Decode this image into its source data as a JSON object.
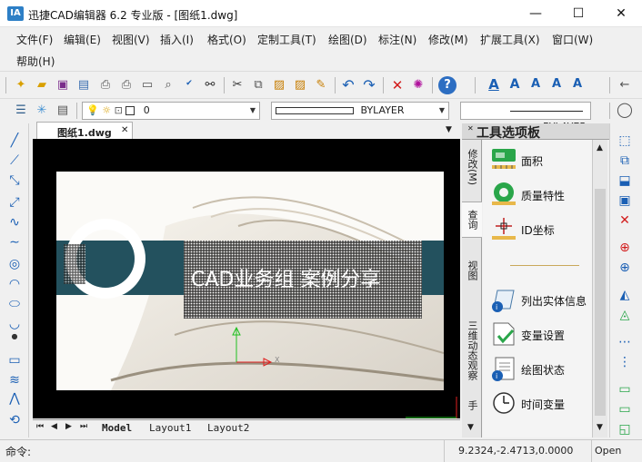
{
  "window": {
    "logo_text": "IA",
    "title": "迅捷CAD编辑器 6.2 专业版  - [图纸1.dwg]",
    "minimize_glyph": "—",
    "maximize_glyph": "☐",
    "close_glyph": "✕"
  },
  "menu": {
    "items": [
      "文件(F)",
      "编辑(E)",
      "视图(V)",
      "插入(I)",
      "格式(O)",
      "定制工具(T)",
      "绘图(D)",
      "标注(N)",
      "修改(M)",
      "扩展工具(X)",
      "窗口(W)",
      "帮助(H)"
    ]
  },
  "layer_toolbar": {
    "layer_value": "0",
    "linetype_value": "BYLAYER",
    "lineweight_value": "BYLAYER"
  },
  "document": {
    "tab_label": "图纸1.dwg",
    "tab_close": "✕",
    "slide_title": "CAD业务组 案例分享",
    "axis_x_label": "X",
    "layout_tabs": [
      "Model",
      "Layout1",
      "Layout2"
    ]
  },
  "palette": {
    "title": "工具选项板",
    "side_tabs": [
      "修改(M)",
      "查询",
      "视图",
      "三维动态观察",
      "手"
    ],
    "items": [
      {
        "label": "面积",
        "icon": "area-icon"
      },
      {
        "label": "质量特性",
        "icon": "mass-properties-icon"
      },
      {
        "label": "ID坐标",
        "icon": "id-point-icon"
      },
      {
        "label": "列出实体信息",
        "icon": "list-icon"
      },
      {
        "label": "变量设置",
        "icon": "setvar-icon"
      },
      {
        "label": "绘图状态",
        "icon": "status-icon"
      },
      {
        "label": "时间变量",
        "icon": "time-icon"
      }
    ]
  },
  "status": {
    "command_label": "命令:",
    "coords": "9.2324,-2.4713,0.0000",
    "open_label": "Open"
  },
  "colors": {
    "teal_band": "#23515e",
    "canvas": "#000000",
    "accent_blue": "#1a5fb4"
  }
}
